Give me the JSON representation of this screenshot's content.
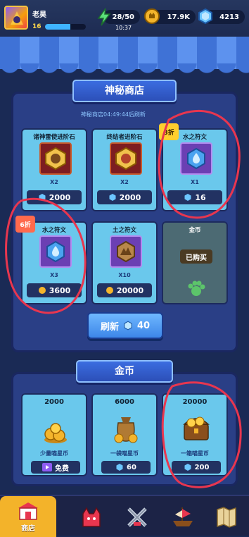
{
  "player": {
    "name": "老昊",
    "level": "16",
    "xp_fraction": 0.62
  },
  "resources": {
    "energy": "28/50",
    "energy_timer": "10:37",
    "gold": "17.9K",
    "gems": "4213"
  },
  "mystery_shop": {
    "title": "神秘商店",
    "refresh_timer": "神秘商店04:49:44后刷新",
    "items": [
      {
        "name": "诸神雷使进阶石",
        "qty": "X2",
        "price": "2000",
        "currency": "gem"
      },
      {
        "name": "终结者进阶石",
        "qty": "X2",
        "price": "2000",
        "currency": "gem"
      },
      {
        "name": "水之符文",
        "qty": "X1",
        "price": "16",
        "currency": "gem",
        "discount": "8折"
      },
      {
        "name": "水之符文",
        "qty": "X3",
        "price": "3600",
        "currency": "gold",
        "discount": "6折"
      },
      {
        "name": "土之符文",
        "qty": "X10",
        "price": "20000",
        "currency": "gold"
      },
      {
        "name": "金币",
        "sold_label": "已购买"
      }
    ],
    "refresh_button": {
      "label": "刷新",
      "cost": "40"
    }
  },
  "gold_shop": {
    "title": "金币",
    "packs": [
      {
        "amount": "2000",
        "label": "少量喵星币",
        "price": "免费"
      },
      {
        "amount": "6000",
        "label": "一袋喵星币",
        "price": "60"
      },
      {
        "amount": "20000",
        "label": "一箱喵星币",
        "price": "200"
      }
    ]
  },
  "nav": {
    "shop_label": "商店"
  },
  "colors": {
    "annotation": "#e8364f",
    "card": "#6ac8ec",
    "panel": "#2a3f86"
  }
}
